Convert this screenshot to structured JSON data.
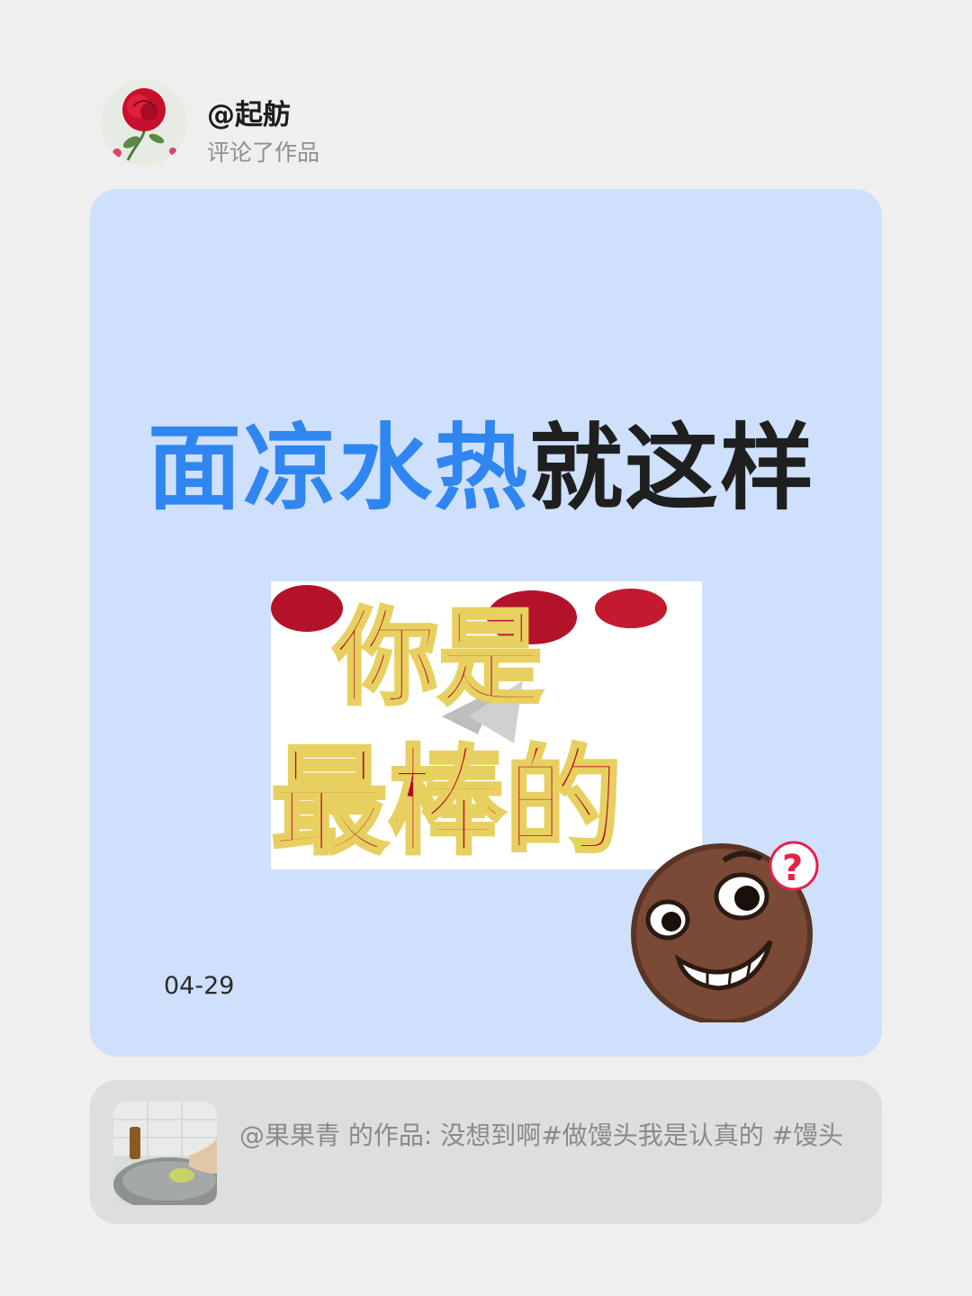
{
  "author": {
    "name": "@起舫",
    "action": "评论了作品"
  },
  "comment": {
    "text_highlight": "面凉水热",
    "text_rest": "就这样",
    "sticker_lines": [
      "你是",
      "最棒的"
    ],
    "date": "04-29"
  },
  "reference": {
    "text": "@果果青 的作品: 没想到啊#做馒头我是认真的 #馒头"
  },
  "colors": {
    "page_bg": "#efefef",
    "card_bg": "#cfe0fc",
    "highlight": "#2f86f0",
    "ref_bg": "#dedede"
  },
  "icons": {
    "avatar": "rose-avatar",
    "emoji": "grinning-question-emoji",
    "thumb": "kitchen-photo-thumbnail"
  }
}
